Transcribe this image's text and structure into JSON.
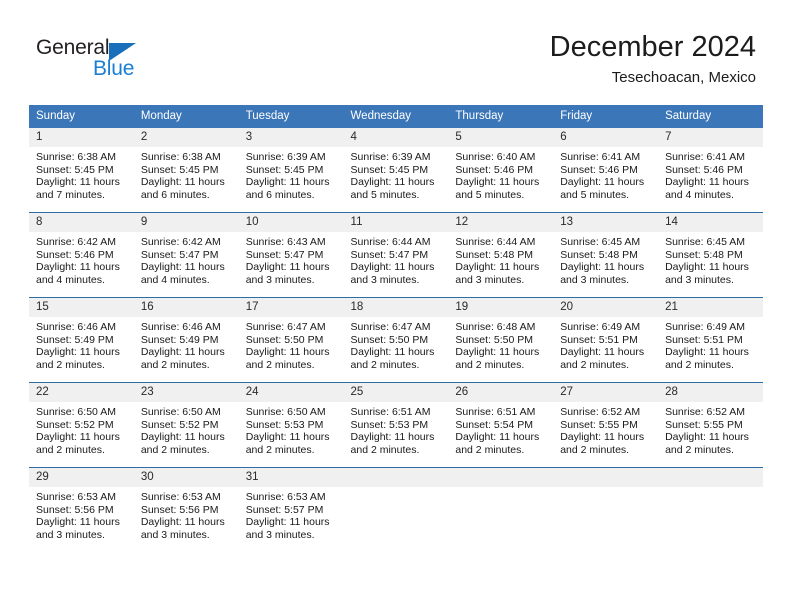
{
  "brand": {
    "name_part1": "General",
    "name_part2": "Blue",
    "color_dark": "#231f20",
    "color_blue": "#1a7fd4"
  },
  "header": {
    "title": "December 2024",
    "subtitle": "Tesechoacan, Mexico"
  },
  "theme": {
    "header_blue": "#3b76b8",
    "row_separator": "#2e6da4",
    "daynum_band": "#f0f0f0"
  },
  "weekday_headers": [
    "Sunday",
    "Monday",
    "Tuesday",
    "Wednesday",
    "Thursday",
    "Friday",
    "Saturday"
  ],
  "weeks": [
    [
      {
        "day": "1",
        "sunrise": "Sunrise: 6:38 AM",
        "sunset": "Sunset: 5:45 PM",
        "daylight_line1": "Daylight: 11 hours",
        "daylight_line2": "and 7 minutes."
      },
      {
        "day": "2",
        "sunrise": "Sunrise: 6:38 AM",
        "sunset": "Sunset: 5:45 PM",
        "daylight_line1": "Daylight: 11 hours",
        "daylight_line2": "and 6 minutes."
      },
      {
        "day": "3",
        "sunrise": "Sunrise: 6:39 AM",
        "sunset": "Sunset: 5:45 PM",
        "daylight_line1": "Daylight: 11 hours",
        "daylight_line2": "and 6 minutes."
      },
      {
        "day": "4",
        "sunrise": "Sunrise: 6:39 AM",
        "sunset": "Sunset: 5:45 PM",
        "daylight_line1": "Daylight: 11 hours",
        "daylight_line2": "and 5 minutes."
      },
      {
        "day": "5",
        "sunrise": "Sunrise: 6:40 AM",
        "sunset": "Sunset: 5:46 PM",
        "daylight_line1": "Daylight: 11 hours",
        "daylight_line2": "and 5 minutes."
      },
      {
        "day": "6",
        "sunrise": "Sunrise: 6:41 AM",
        "sunset": "Sunset: 5:46 PM",
        "daylight_line1": "Daylight: 11 hours",
        "daylight_line2": "and 5 minutes."
      },
      {
        "day": "7",
        "sunrise": "Sunrise: 6:41 AM",
        "sunset": "Sunset: 5:46 PM",
        "daylight_line1": "Daylight: 11 hours",
        "daylight_line2": "and 4 minutes."
      }
    ],
    [
      {
        "day": "8",
        "sunrise": "Sunrise: 6:42 AM",
        "sunset": "Sunset: 5:46 PM",
        "daylight_line1": "Daylight: 11 hours",
        "daylight_line2": "and 4 minutes."
      },
      {
        "day": "9",
        "sunrise": "Sunrise: 6:42 AM",
        "sunset": "Sunset: 5:47 PM",
        "daylight_line1": "Daylight: 11 hours",
        "daylight_line2": "and 4 minutes."
      },
      {
        "day": "10",
        "sunrise": "Sunrise: 6:43 AM",
        "sunset": "Sunset: 5:47 PM",
        "daylight_line1": "Daylight: 11 hours",
        "daylight_line2": "and 3 minutes."
      },
      {
        "day": "11",
        "sunrise": "Sunrise: 6:44 AM",
        "sunset": "Sunset: 5:47 PM",
        "daylight_line1": "Daylight: 11 hours",
        "daylight_line2": "and 3 minutes."
      },
      {
        "day": "12",
        "sunrise": "Sunrise: 6:44 AM",
        "sunset": "Sunset: 5:48 PM",
        "daylight_line1": "Daylight: 11 hours",
        "daylight_line2": "and 3 minutes."
      },
      {
        "day": "13",
        "sunrise": "Sunrise: 6:45 AM",
        "sunset": "Sunset: 5:48 PM",
        "daylight_line1": "Daylight: 11 hours",
        "daylight_line2": "and 3 minutes."
      },
      {
        "day": "14",
        "sunrise": "Sunrise: 6:45 AM",
        "sunset": "Sunset: 5:48 PM",
        "daylight_line1": "Daylight: 11 hours",
        "daylight_line2": "and 3 minutes."
      }
    ],
    [
      {
        "day": "15",
        "sunrise": "Sunrise: 6:46 AM",
        "sunset": "Sunset: 5:49 PM",
        "daylight_line1": "Daylight: 11 hours",
        "daylight_line2": "and 2 minutes."
      },
      {
        "day": "16",
        "sunrise": "Sunrise: 6:46 AM",
        "sunset": "Sunset: 5:49 PM",
        "daylight_line1": "Daylight: 11 hours",
        "daylight_line2": "and 2 minutes."
      },
      {
        "day": "17",
        "sunrise": "Sunrise: 6:47 AM",
        "sunset": "Sunset: 5:50 PM",
        "daylight_line1": "Daylight: 11 hours",
        "daylight_line2": "and 2 minutes."
      },
      {
        "day": "18",
        "sunrise": "Sunrise: 6:47 AM",
        "sunset": "Sunset: 5:50 PM",
        "daylight_line1": "Daylight: 11 hours",
        "daylight_line2": "and 2 minutes."
      },
      {
        "day": "19",
        "sunrise": "Sunrise: 6:48 AM",
        "sunset": "Sunset: 5:50 PM",
        "daylight_line1": "Daylight: 11 hours",
        "daylight_line2": "and 2 minutes."
      },
      {
        "day": "20",
        "sunrise": "Sunrise: 6:49 AM",
        "sunset": "Sunset: 5:51 PM",
        "daylight_line1": "Daylight: 11 hours",
        "daylight_line2": "and 2 minutes."
      },
      {
        "day": "21",
        "sunrise": "Sunrise: 6:49 AM",
        "sunset": "Sunset: 5:51 PM",
        "daylight_line1": "Daylight: 11 hours",
        "daylight_line2": "and 2 minutes."
      }
    ],
    [
      {
        "day": "22",
        "sunrise": "Sunrise: 6:50 AM",
        "sunset": "Sunset: 5:52 PM",
        "daylight_line1": "Daylight: 11 hours",
        "daylight_line2": "and 2 minutes."
      },
      {
        "day": "23",
        "sunrise": "Sunrise: 6:50 AM",
        "sunset": "Sunset: 5:52 PM",
        "daylight_line1": "Daylight: 11 hours",
        "daylight_line2": "and 2 minutes."
      },
      {
        "day": "24",
        "sunrise": "Sunrise: 6:50 AM",
        "sunset": "Sunset: 5:53 PM",
        "daylight_line1": "Daylight: 11 hours",
        "daylight_line2": "and 2 minutes."
      },
      {
        "day": "25",
        "sunrise": "Sunrise: 6:51 AM",
        "sunset": "Sunset: 5:53 PM",
        "daylight_line1": "Daylight: 11 hours",
        "daylight_line2": "and 2 minutes."
      },
      {
        "day": "26",
        "sunrise": "Sunrise: 6:51 AM",
        "sunset": "Sunset: 5:54 PM",
        "daylight_line1": "Daylight: 11 hours",
        "daylight_line2": "and 2 minutes."
      },
      {
        "day": "27",
        "sunrise": "Sunrise: 6:52 AM",
        "sunset": "Sunset: 5:55 PM",
        "daylight_line1": "Daylight: 11 hours",
        "daylight_line2": "and 2 minutes."
      },
      {
        "day": "28",
        "sunrise": "Sunrise: 6:52 AM",
        "sunset": "Sunset: 5:55 PM",
        "daylight_line1": "Daylight: 11 hours",
        "daylight_line2": "and 2 minutes."
      }
    ],
    [
      {
        "day": "29",
        "sunrise": "Sunrise: 6:53 AM",
        "sunset": "Sunset: 5:56 PM",
        "daylight_line1": "Daylight: 11 hours",
        "daylight_line2": "and 3 minutes."
      },
      {
        "day": "30",
        "sunrise": "Sunrise: 6:53 AM",
        "sunset": "Sunset: 5:56 PM",
        "daylight_line1": "Daylight: 11 hours",
        "daylight_line2": "and 3 minutes."
      },
      {
        "day": "31",
        "sunrise": "Sunrise: 6:53 AM",
        "sunset": "Sunset: 5:57 PM",
        "daylight_line1": "Daylight: 11 hours",
        "daylight_line2": "and 3 minutes."
      },
      {
        "day": "",
        "sunrise": "",
        "sunset": "",
        "daylight_line1": "",
        "daylight_line2": ""
      },
      {
        "day": "",
        "sunrise": "",
        "sunset": "",
        "daylight_line1": "",
        "daylight_line2": ""
      },
      {
        "day": "",
        "sunrise": "",
        "sunset": "",
        "daylight_line1": "",
        "daylight_line2": ""
      },
      {
        "day": "",
        "sunrise": "",
        "sunset": "",
        "daylight_line1": "",
        "daylight_line2": ""
      }
    ]
  ]
}
